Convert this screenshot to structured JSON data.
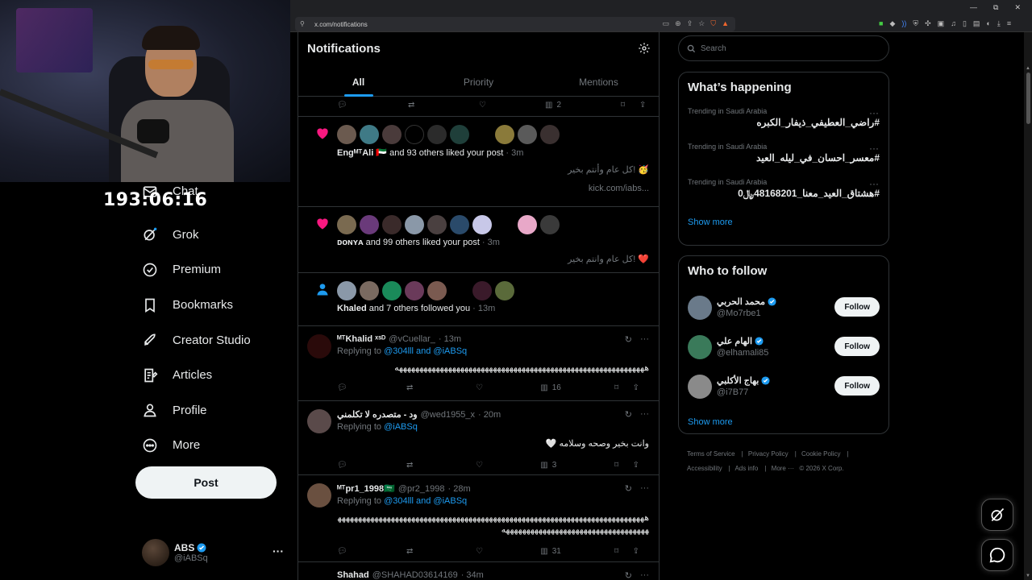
{
  "stream": {
    "timer": "193:06:16"
  },
  "browser": {
    "url": "x.com/notifications",
    "win_minimize": "—",
    "win_restore": "⧉",
    "win_close": "✕"
  },
  "nav": {
    "items": [
      {
        "label": "Chat",
        "icon": "mail-icon"
      },
      {
        "label": "Grok",
        "icon": "grok-icon"
      },
      {
        "label": "Premium",
        "icon": "verified-icon"
      },
      {
        "label": "Bookmarks",
        "icon": "bookmark-icon"
      },
      {
        "label": "Creator Studio",
        "icon": "rocket-icon"
      },
      {
        "label": "Articles",
        "icon": "article-icon"
      },
      {
        "label": "Profile",
        "icon": "person-icon"
      },
      {
        "label": "More",
        "icon": "more-circle-icon"
      }
    ],
    "post_label": "Post"
  },
  "account": {
    "display_name": "ABS",
    "handle": "@iABSq",
    "more": "···"
  },
  "header": {
    "title": "Notifications",
    "tabs": [
      {
        "label": "All"
      },
      {
        "label": "Priority"
      },
      {
        "label": "Mentions"
      }
    ]
  },
  "top_actions": {
    "views": "2"
  },
  "likes": [
    {
      "name": "EngᴹᵀAli 🇦🇪",
      "rest": " and 93 others liked your post",
      "time": " · 3m",
      "snippet1": "كل عام وأنتم بخير! 🥳",
      "snippet2": "kick.com/iabs..."
    },
    {
      "name": "ᴅᴏɴʏᴀ",
      "rest": " and 99 others liked your post",
      "time": " · 3m",
      "snippet1": "كل عام وانتم بخير! ❤️"
    }
  ],
  "follow_notif": {
    "name": "Khaled",
    "rest": " and 7 others followed you",
    "time": " · 13m"
  },
  "replies": [
    {
      "name": "ᴹᵀKhalid ˣˢᴰ",
      "handle": "@vCuellar_",
      "time": "· 13m",
      "replying_prefix": "Replying to ",
      "replying_to": "@304lll and @iABSq",
      "body": "هههههههههههههههههههههههههههههههههههههههههههههههههههههههههههههه",
      "views": "16"
    },
    {
      "name": "ود - متصدره لا تكلمني",
      "handle": "@wed1955_x",
      "time": "· 20m",
      "replying_prefix": "Replying to ",
      "replying_to": "@iABSq",
      "body": "وانت بخير وصحه وسلامه 🤍",
      "views": "3"
    },
    {
      "name": "ᴹᵀpr1_1998🇸🇦",
      "handle": "@pr2_1998",
      "time": "· 28m",
      "replying_prefix": "Replying to ",
      "replying_to": "@304lll and @iABSq",
      "body": "هههههههههههههههههههههههههههههههههههههههههههههههههههههههههههههههههههههههههههههههههههههههههههههههههههههههههههههههه",
      "views": "31"
    },
    {
      "name": "Shahad",
      "handle": "@SHAHAD03614169",
      "time": "· 34m"
    }
  ],
  "search": {
    "placeholder": "Search"
  },
  "happening": {
    "title": "What’s happening",
    "trends": [
      {
        "context": "Trending in Saudi Arabia",
        "tag": "#راضي_العطيفي_ذيفار_الكبره"
      },
      {
        "context": "Trending in Saudi Arabia",
        "tag": "#معسر_احسان_في_ليله_العيد"
      },
      {
        "context": "Trending in Saudi Arabia",
        "tag": "#هشتاق_العيد_معنا_48168201﷼0"
      }
    ],
    "show_more": "Show more"
  },
  "who_to_follow": {
    "title": "Who to follow",
    "users": [
      {
        "name": "محمد الحربي",
        "handle": "@Mo7rbe1",
        "button": "Follow"
      },
      {
        "name": "الهام علي",
        "handle": "@elhamali85",
        "button": "Follow"
      },
      {
        "name": "بهاج الأكلبي",
        "handle": "@i7B77",
        "button": "Follow"
      }
    ],
    "show_more": "Show more"
  },
  "footer": {
    "links": [
      "Terms of Service",
      "Privacy Policy",
      "Cookie Policy",
      "Accessibility",
      "Ads info",
      "More ···"
    ],
    "copyright": "© 2026 X Corp."
  },
  "colors": {
    "accent": "#1d9bf0",
    "heart": "#f91880",
    "verified": "#1d9bf0",
    "background": "#000000"
  }
}
